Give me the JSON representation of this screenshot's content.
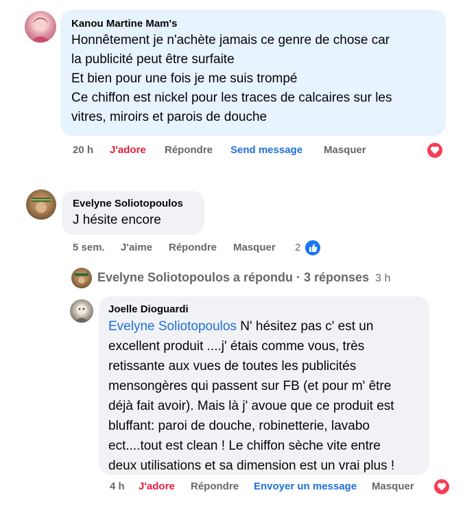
{
  "comments": [
    {
      "author": "Kanou Martine Mam's",
      "lines": [
        "Honnêtement je n'achète jamais ce genre de chose car",
        "la publicité peut être surfaite",
        "Et bien pour une fois je me suis trompé",
        "Ce chiffon est nickel pour les traces de calcaires sur les",
        "vitres, miroirs et parois de douche"
      ],
      "time": "20 h",
      "reaction_label": "J'adore",
      "reply_label": "Répondre",
      "message_label": "Send message",
      "hide_label": "Masquer",
      "reaction_icon": "heart-reaction-icon"
    },
    {
      "author": "Evelyne Soliotopoulos",
      "lines": [
        "J hésite encore"
      ],
      "time": "5 sem.",
      "reaction_label": "J'aime",
      "reply_label": "Répondre",
      "hide_label": "Masquer",
      "reaction_count": "2",
      "reaction_icon": "like-reaction-icon"
    }
  ],
  "reply_summary": {
    "text": "Evelyne Soliotopoulos a répondu · 3 réponses",
    "time": "3 h"
  },
  "reply": {
    "author": "Joelle Dioguardi",
    "mention": "Evelyne Soliotopoulos",
    "first_line_rest": " N' hésitez pas c' est un",
    "lines": [
      "excellent produit ....j' étais comme vous, très",
      "retissante aux vues de toutes les publicités",
      "mensongères qui passent sur FB (et pour m' être",
      "déjà fait avoir). Mais là j' avoue que ce produit est",
      "bluffant: paroi de douche, robinetterie, lavabo",
      "ect....tout est clean ! Le chiffon sèche vite entre",
      "deux utilisations et sa dimension est un vrai plus !"
    ],
    "time": "4 h",
    "reaction_label": "J'adore",
    "reply_label": "Répondre",
    "message_label": "Envoyer un message",
    "hide_label": "Masquer",
    "reaction_icon": "heart-reaction-icon"
  },
  "colors": {
    "bubble": "#f0f2f5",
    "bubble_highlight": "#e7f3ff",
    "love": "#e41e3f",
    "link": "#216fdb",
    "meta": "#65676b"
  }
}
